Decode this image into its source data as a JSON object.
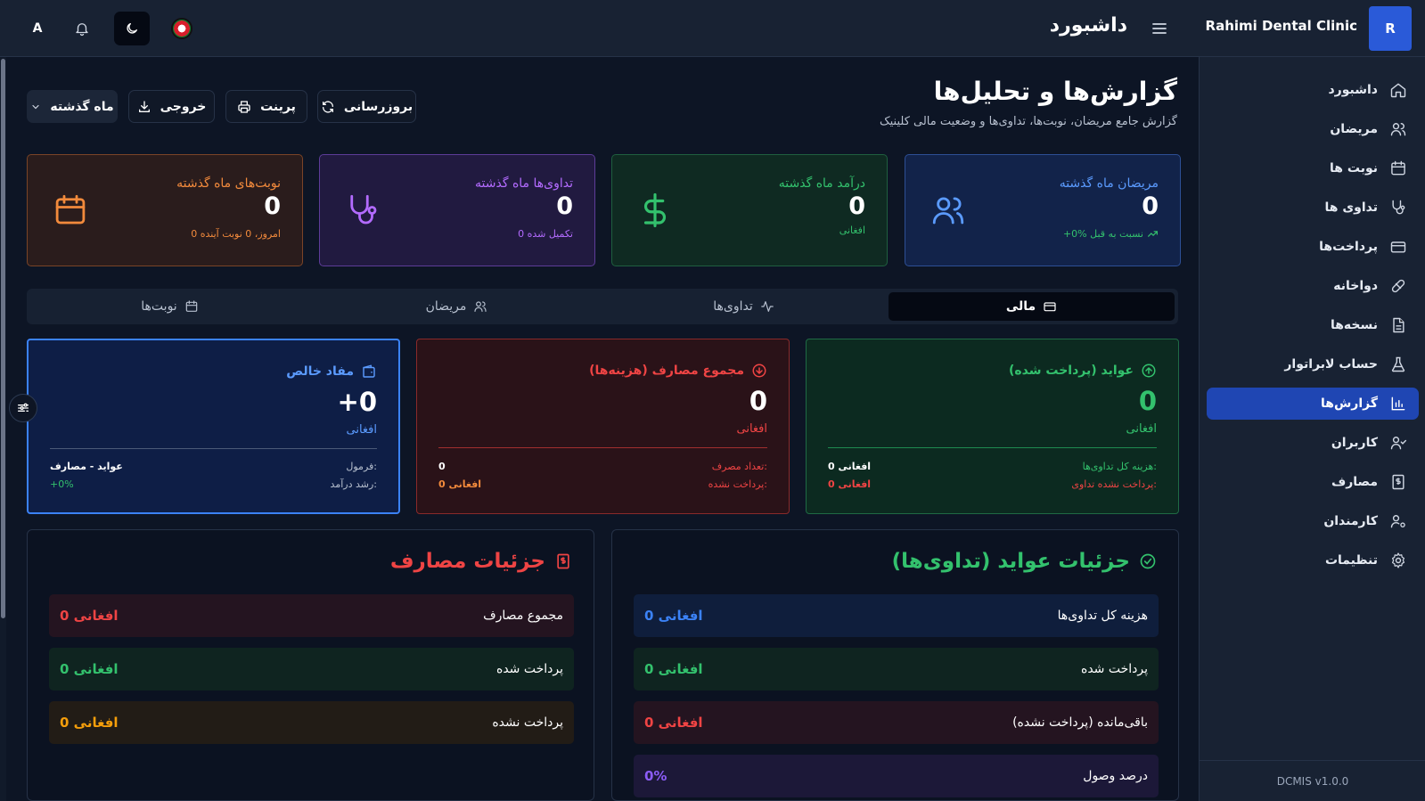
{
  "header": {
    "logo_letter": "R",
    "clinic_name": "Rahimi Dental Clinic",
    "title": "داشبورد",
    "avatar_letter": "A"
  },
  "sidebar": {
    "items": [
      {
        "label": "داشبورد",
        "icon": "home-icon"
      },
      {
        "label": "مریضان",
        "icon": "users-icon"
      },
      {
        "label": "نوبت ها",
        "icon": "calendar-icon"
      },
      {
        "label": "تداوی ها",
        "icon": "stethoscope-icon"
      },
      {
        "label": "پرداخت‌ها",
        "icon": "credit-card-icon"
      },
      {
        "label": "دواخانه",
        "icon": "pill-icon"
      },
      {
        "label": "نسخه‌ها",
        "icon": "file-text-icon"
      },
      {
        "label": "حساب لابراتوار",
        "icon": "flask-icon"
      },
      {
        "label": "گزارش‌ها",
        "icon": "bar-chart-icon",
        "active": true
      },
      {
        "label": "کاربران",
        "icon": "user-check-icon"
      },
      {
        "label": "مصارف",
        "icon": "receipt-icon"
      },
      {
        "label": "کارمندان",
        "icon": "user-cog-icon"
      },
      {
        "label": "تنظیمات",
        "icon": "gear-icon"
      }
    ],
    "version": "DCMIS v1.0.0"
  },
  "page": {
    "title": "گزارش‌ها و تحلیل‌ها",
    "subtitle": "گزارش جامع مریضان، نوبت‌ها، تداوی‌ها و وضعیت مالی کلینیک"
  },
  "toolbar": {
    "refresh_label": "بروزرسانی",
    "print_label": "پرینت",
    "export_label": "خروجی",
    "period_label": "ماه گذشته"
  },
  "stats": {
    "patients": {
      "label": "مریضان ماه گذشته",
      "value": "0",
      "sub": "+0% نسبت به قبل",
      "color": "#5b9bff"
    },
    "income": {
      "label": "درآمد ماه گذشته",
      "value": "0",
      "sub": "افغانی",
      "color": "#33c16d"
    },
    "treatments": {
      "label": "تداوی‌ها ماه گذشته",
      "value": "0",
      "sub": "0 تکمیل شده",
      "color": "#b36bff"
    },
    "appointments": {
      "label": "نوبت‌های ماه گذشته",
      "value": "0",
      "sub": "0 امروز، 0 نوبت آینده",
      "color": "#f28a3c"
    }
  },
  "tabs": [
    {
      "label": "مالی",
      "icon": "credit-card-icon",
      "active": true
    },
    {
      "label": "تداوی‌ها",
      "icon": "activity-icon"
    },
    {
      "label": "مریضان",
      "icon": "users-icon"
    },
    {
      "label": "نوبت‌ها",
      "icon": "calendar-icon"
    }
  ],
  "finance": {
    "income": {
      "title": "عواید (پرداخت شده)",
      "value": "0",
      "unit": "افغانی",
      "row1_label": "هزینه کل تداوی‌ها:",
      "row1_value": "0 افغانی",
      "row2_label": "پرداخت نشده تداوی:",
      "row2_value": "0 افغانی"
    },
    "expenses": {
      "title": "مجموع مصارف (هزینه‌ها)",
      "value": "0",
      "unit": "افغانی",
      "row1_label": "تعداد مصرف:",
      "row1_value": "0",
      "row2_label": "پرداخت نشده:",
      "row2_value": "0 افغانی"
    },
    "profit": {
      "title": "مفاد خالص",
      "value": "+0",
      "unit": "افغانی",
      "row1_label": "فرمول:",
      "row1_value": "عواید - مصارف",
      "row2_label": "رشد درآمد:",
      "row2_value": "+0%"
    }
  },
  "income_details": {
    "title": "جزئیات عواید (تداوی‌ها)",
    "rows": [
      {
        "label": "هزینه کل تداوی‌ها",
        "value": "0 افغانی"
      },
      {
        "label": "پرداخت شده",
        "value": "0 افغانی"
      },
      {
        "label": "باقی‌مانده (پرداخت نشده)",
        "value": "0 افغانی"
      },
      {
        "label": "درصد وصول",
        "value": "0%"
      }
    ]
  },
  "expense_details": {
    "title": "جزئیات مصارف",
    "rows": [
      {
        "label": "مجموع مصارف",
        "value": "0 افغانی"
      },
      {
        "label": "پرداخت شده",
        "value": "0 افغانی"
      },
      {
        "label": "پرداخت نشده",
        "value": "0 افغانی"
      }
    ]
  }
}
